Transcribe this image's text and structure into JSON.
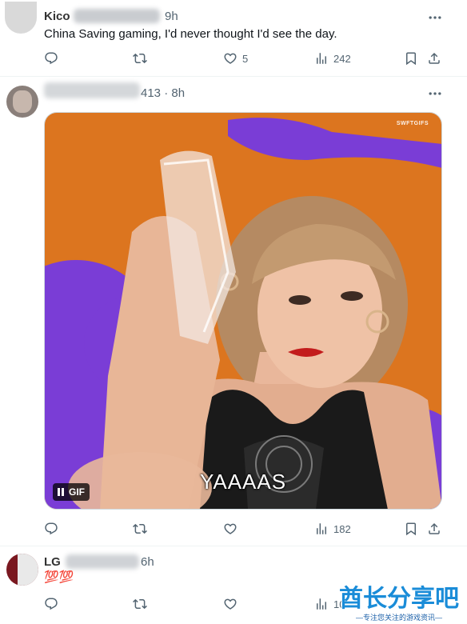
{
  "tweets": [
    {
      "time_suffix": "9h",
      "text": "China Saving gaming, I'd never thought I'd see the day.",
      "actions": {
        "reply": "",
        "retweet": "",
        "like": "5",
        "views": "242"
      }
    },
    {
      "time_suffix": "413 · 8h",
      "media": {
        "caption": "YAAAAS",
        "badge": "GIF",
        "source_watermark": "SWFTGIFS"
      },
      "actions": {
        "reply": "",
        "retweet": "",
        "like": "",
        "views": "182"
      }
    },
    {
      "time_suffix": "6h",
      "text": "💯💯",
      "actions": {
        "reply": "",
        "retweet": "",
        "like": "",
        "views": "109"
      }
    }
  ],
  "site_watermark": {
    "title": "酋长分享吧",
    "subtitle": "—专注您关注的游戏资讯—"
  },
  "colors": {
    "text_secondary": "#536471",
    "watermark_blue": "#1a8cd8",
    "gif_background_orange": "#e8761c",
    "gif_background_purple": "#7a3dd6"
  },
  "icons": [
    "reply-icon",
    "retweet-icon",
    "like-icon",
    "views-icon",
    "bookmark-icon",
    "share-icon",
    "more-icon",
    "pause-icon"
  ]
}
